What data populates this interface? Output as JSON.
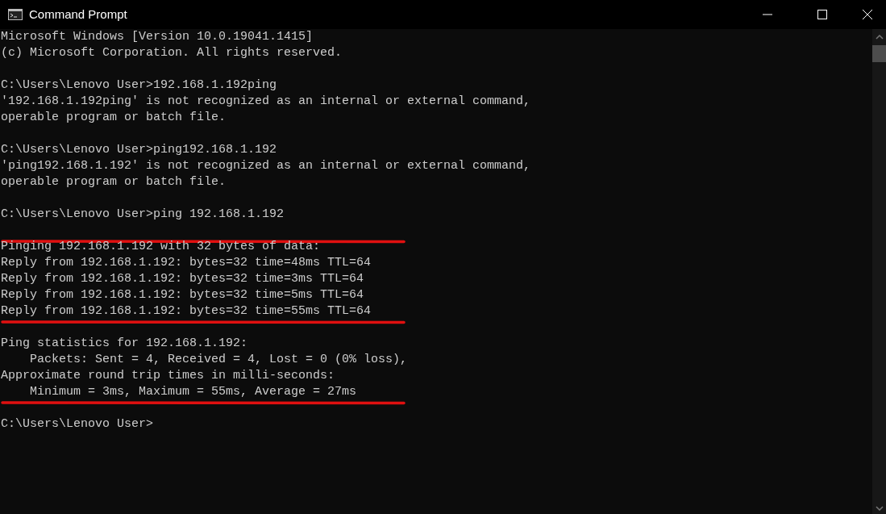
{
  "window": {
    "title": "Command Prompt"
  },
  "console": {
    "lines": [
      {
        "kind": "text",
        "text": "Microsoft Windows [Version 10.0.19041.1415]"
      },
      {
        "kind": "text",
        "text": "(c) Microsoft Corporation. All rights reserved."
      },
      {
        "kind": "blank"
      },
      {
        "kind": "text",
        "text": "C:\\Users\\Lenovo User>192.168.1.192ping"
      },
      {
        "kind": "text",
        "text": "'192.168.1.192ping' is not recognized as an internal or external command,"
      },
      {
        "kind": "text",
        "text": "operable program or batch file."
      },
      {
        "kind": "blank"
      },
      {
        "kind": "text",
        "text": "C:\\Users\\Lenovo User>ping192.168.1.192"
      },
      {
        "kind": "text",
        "text": "'ping192.168.1.192' is not recognized as an internal or external command,"
      },
      {
        "kind": "text",
        "text": "operable program or batch file."
      },
      {
        "kind": "blank"
      },
      {
        "kind": "text",
        "text": "C:\\Users\\Lenovo User>ping 192.168.1.192"
      },
      {
        "kind": "blank",
        "underlined": true
      },
      {
        "kind": "text",
        "text": "Pinging 192.168.1.192 with 32 bytes of data:"
      },
      {
        "kind": "text",
        "text": "Reply from 192.168.1.192: bytes=32 time=48ms TTL=64"
      },
      {
        "kind": "text",
        "text": "Reply from 192.168.1.192: bytes=32 time=3ms TTL=64"
      },
      {
        "kind": "text",
        "text": "Reply from 192.168.1.192: bytes=32 time=5ms TTL=64"
      },
      {
        "kind": "text",
        "text": "Reply from 192.168.1.192: bytes=32 time=55ms TTL=64",
        "underlined": true
      },
      {
        "kind": "blank"
      },
      {
        "kind": "text",
        "text": "Ping statistics for 192.168.1.192:"
      },
      {
        "kind": "text",
        "text": "    Packets: Sent = 4, Received = 4, Lost = 0 (0% loss),"
      },
      {
        "kind": "text",
        "text": "Approximate round trip times in milli-seconds:"
      },
      {
        "kind": "text",
        "text": "    Minimum = 3ms, Maximum = 55ms, Average = 27ms",
        "underlined": true
      },
      {
        "kind": "blank"
      },
      {
        "kind": "text",
        "text": "C:\\Users\\Lenovo User>"
      }
    ]
  }
}
